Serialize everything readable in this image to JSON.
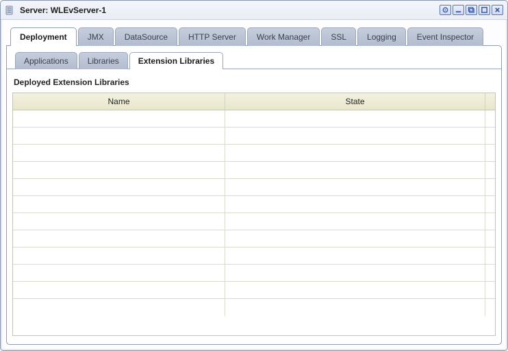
{
  "title_prefix": "Server: ",
  "server_name": "WLEvServer-1",
  "primary_tabs": [
    {
      "label": "Deployment",
      "active": true
    },
    {
      "label": "JMX"
    },
    {
      "label": "DataSource"
    },
    {
      "label": "HTTP Server"
    },
    {
      "label": "Work Manager"
    },
    {
      "label": "SSL"
    },
    {
      "label": "Logging"
    },
    {
      "label": "Event Inspector"
    }
  ],
  "secondary_tabs": [
    {
      "label": "Applications"
    },
    {
      "label": "Libraries"
    },
    {
      "label": "Extension Libraries",
      "active": true
    }
  ],
  "section_title": "Deployed Extension Libraries",
  "columns": {
    "name": "Name",
    "state": "State"
  },
  "rows": [
    {
      "name": "",
      "state": ""
    },
    {
      "name": "",
      "state": ""
    },
    {
      "name": "",
      "state": ""
    },
    {
      "name": "",
      "state": ""
    },
    {
      "name": "",
      "state": ""
    },
    {
      "name": "",
      "state": ""
    },
    {
      "name": "",
      "state": ""
    },
    {
      "name": "",
      "state": ""
    },
    {
      "name": "",
      "state": ""
    },
    {
      "name": "",
      "state": ""
    },
    {
      "name": "",
      "state": ""
    },
    {
      "name": "",
      "state": ""
    }
  ]
}
